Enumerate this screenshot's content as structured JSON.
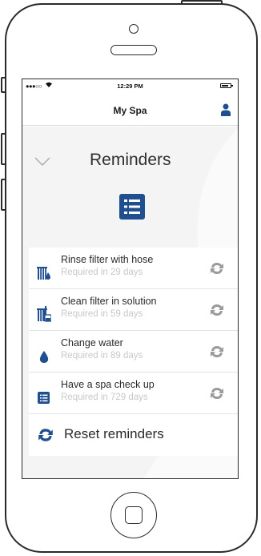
{
  "status_bar": {
    "signal": "●●●○○",
    "time": "12:29 PM"
  },
  "nav": {
    "title": "My Spa"
  },
  "section": {
    "title": "Reminders"
  },
  "reminders": [
    {
      "title": "Rinse filter with hose",
      "subtitle": "Required in 29 days",
      "icon": "filter-rinse-icon"
    },
    {
      "title": "Clean filter in solution",
      "subtitle": "Required in 59 days",
      "icon": "filter-clean-icon"
    },
    {
      "title": "Change water",
      "subtitle": "Required in 89 days",
      "icon": "water-drop-icon"
    },
    {
      "title": "Have a spa check up",
      "subtitle": "Required in 729 days",
      "icon": "checklist-icon"
    }
  ],
  "reset": {
    "label": "Reset reminders"
  },
  "colors": {
    "accent": "#1f4f8f",
    "sync_gray": "#9a9a9a",
    "subtitle_gray": "#c8c8c8",
    "background": "#f4f4f4"
  }
}
